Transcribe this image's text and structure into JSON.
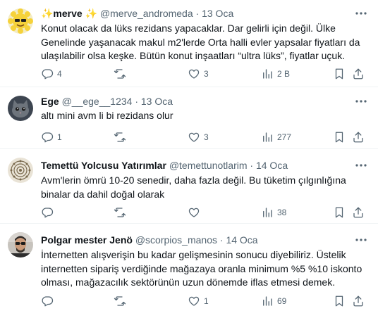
{
  "tweets": [
    {
      "name": "✨merve ✨",
      "handle": "@merve_andromeda",
      "separator": "·",
      "date": "13 Oca",
      "lines": [
        "Konut olacak da lüks rezidans yapacaklar. Dar gelirli için değil. Ülke",
        "Genelinde yaşanacak makul m2'lerde Orta halli evler yapsalar fiyatları da",
        "ulaşılabilir olsa keşke. Bütün konut inşaatları “ultra lüks”, fiyatlar uçuk."
      ],
      "replies": "4",
      "retweets": "",
      "likes": "3",
      "views": "2 B"
    },
    {
      "name": "Ege",
      "handle": "@__ege__1234",
      "separator": "·",
      "date": "13 Oca",
      "lines": [
        "altı mini avm li bi rezidans olur"
      ],
      "replies": "1",
      "retweets": "",
      "likes": "3",
      "views": "277"
    },
    {
      "name": "Temettü Yolcusu Yatırımlar",
      "handle": "@temettunotlarim",
      "separator": "·",
      "date": "14 Oca",
      "lines": [
        "Avm'lerin ömrü 10-20 senedir, daha fazla değil. Bu tüketim çılgınlığına",
        "binalar da dahil doğal olarak"
      ],
      "replies": "",
      "retweets": "",
      "likes": "",
      "views": "38"
    },
    {
      "name": "Polgar mester Jenö",
      "handle": "@scorpios_manos",
      "separator": "·",
      "date": "14 Oca",
      "lines": [
        "İnternetten alışverişin bu kadar gelişmesinin sonucu diyebiliriz. Üstelik",
        "internetten sipariş verdiğinde mağazaya oranla minimum %5 %10 iskonto",
        "olması, mağazacılık sektörünün uzun dönemde iflas etmesi demek."
      ],
      "replies": "",
      "retweets": "",
      "likes": "1",
      "views": "69"
    }
  ],
  "icons": {
    "reply": "reply-icon",
    "retweet": "retweet-icon",
    "like": "like-icon",
    "views": "views-icon",
    "bookmark": "bookmark-icon",
    "share": "share-icon",
    "more": "more-icon"
  },
  "colors": {
    "text": "#0f1419",
    "secondary": "#536471",
    "border": "#eff3f4"
  }
}
